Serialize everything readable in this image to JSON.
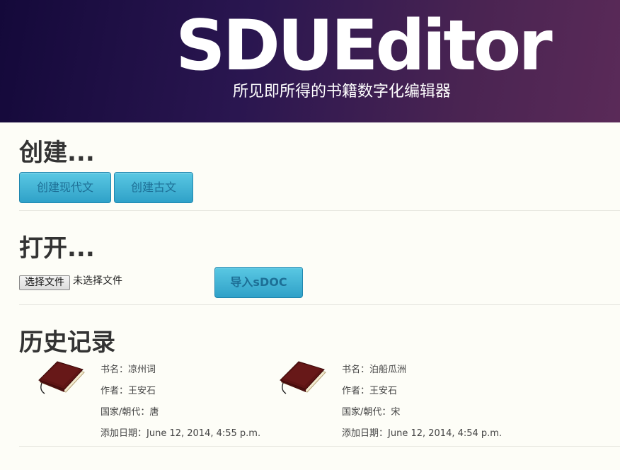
{
  "header": {
    "brand": "SDUEditor",
    "tagline": "所见即所得的书籍数字化编辑器"
  },
  "create": {
    "title": "创建...",
    "modern_button": "创建现代文",
    "classical_button": "创建古文"
  },
  "open": {
    "title": "打开...",
    "choose_file_button": "选择文件",
    "no_file_text": "未选择文件",
    "import_button": "导入sDOC"
  },
  "history": {
    "title": "历史记录",
    "items": [
      {
        "book_name": "书名：凉州词",
        "author": "作者：王安石",
        "dynasty": "国家/朝代：唐",
        "added": "添加日期：June 12, 2014, 4:55 p.m."
      },
      {
        "book_name": "书名：泊船瓜洲",
        "author": "作者：王安石",
        "dynasty": "国家/朝代：宋",
        "added": "添加日期：June 12, 2014, 4:54 p.m."
      }
    ]
  },
  "colors": {
    "hero_start": "#14093a",
    "hero_end": "#5a2a58",
    "button": "#2fa1c8",
    "background": "#fdfdf7"
  },
  "icons": [
    "book-icon"
  ]
}
